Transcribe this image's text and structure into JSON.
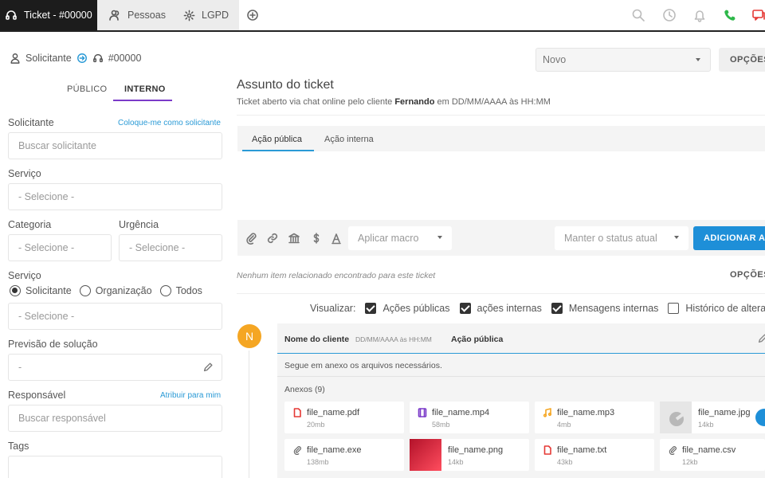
{
  "tabs": {
    "ticket": "Ticket - #00000",
    "pessoas": "Pessoas",
    "lgpd": "LGPD"
  },
  "crumb": {
    "solicitante": "Solicitante",
    "ticket_id": "#00000"
  },
  "left_tabs": {
    "publico": "PÚBLICO",
    "interno": "INTERNO"
  },
  "form": {
    "solicitante_label": "Solicitante",
    "solicitante_link": "Coloque-me como solicitante",
    "solicitante_placeholder": "Buscar solicitante",
    "servico_label": "Serviço",
    "servico_value": "- Selecione -",
    "categoria_label": "Categoria",
    "categoria_value": "- Selecione -",
    "urgencia_label": "Urgência",
    "urgencia_value": "- Selecione -",
    "servico2_label": "Serviço",
    "radio_solicitante": "Solicitante",
    "radio_organizacao": "Organização",
    "radio_todos": "Todos",
    "servico2_value": "- Selecione -",
    "previsao_label": "Previsão de solução",
    "previsao_value": "-",
    "responsavel_label": "Responsável",
    "responsavel_link": "Atribuir para mim",
    "responsavel_placeholder": "Buscar responsável",
    "tags_label": "Tags"
  },
  "header": {
    "status": "Novo",
    "opcoes": "OPÇÕES",
    "subject": "Assunto do ticket",
    "sub_prefix": "Ticket aberto via chat online pelo cliente ",
    "sub_client": "Fernando",
    "sub_suffix": " em DD/MM/AAAA às HH:MM"
  },
  "editor": {
    "tab_public": "Ação pública",
    "tab_internal": "Ação interna",
    "macro": "Aplicar macro",
    "keep_status": "Manter o status atual",
    "add_action": "ADICIONAR AÇÃO"
  },
  "related": {
    "empty": "Nenhum item relacionado encontrado para este ticket",
    "opcoes": "OPÇÕES"
  },
  "visualizar": {
    "label": "Visualizar:",
    "acoes_publicas": "Ações públicas",
    "acoes_internas": "ações internas",
    "mensagens_internas": "Mensagens internas",
    "historico": "Histórico de alterações"
  },
  "card": {
    "avatar": "N",
    "name": "Nome do cliente",
    "date": "DD/MM/AAAA às HH:MM",
    "type": "Ação pública",
    "message": "Segue em anexo os arquivos necessários.",
    "attachments_title": "Anexos (9)"
  },
  "files": [
    {
      "name": "file_name.pdf",
      "size": "20mb"
    },
    {
      "name": "file_name.mp4",
      "size": "58mb"
    },
    {
      "name": "file_name.mp3",
      "size": "4mb"
    },
    {
      "name": "file_name.jpg",
      "size": "14kb"
    },
    {
      "name": "file_name.exe",
      "size": "138mb"
    },
    {
      "name": "file_name.png",
      "size": "14kb"
    },
    {
      "name": "file_name.txt",
      "size": "43kb"
    },
    {
      "name": "file_name.csv",
      "size": "12kb"
    }
  ],
  "colors": {
    "accent_blue": "#1e8fd8",
    "accent_purple": "#7b3bc9",
    "phone_green": "#2eb84a",
    "alert_red": "#e53935",
    "avatar_orange": "#f5a623"
  }
}
